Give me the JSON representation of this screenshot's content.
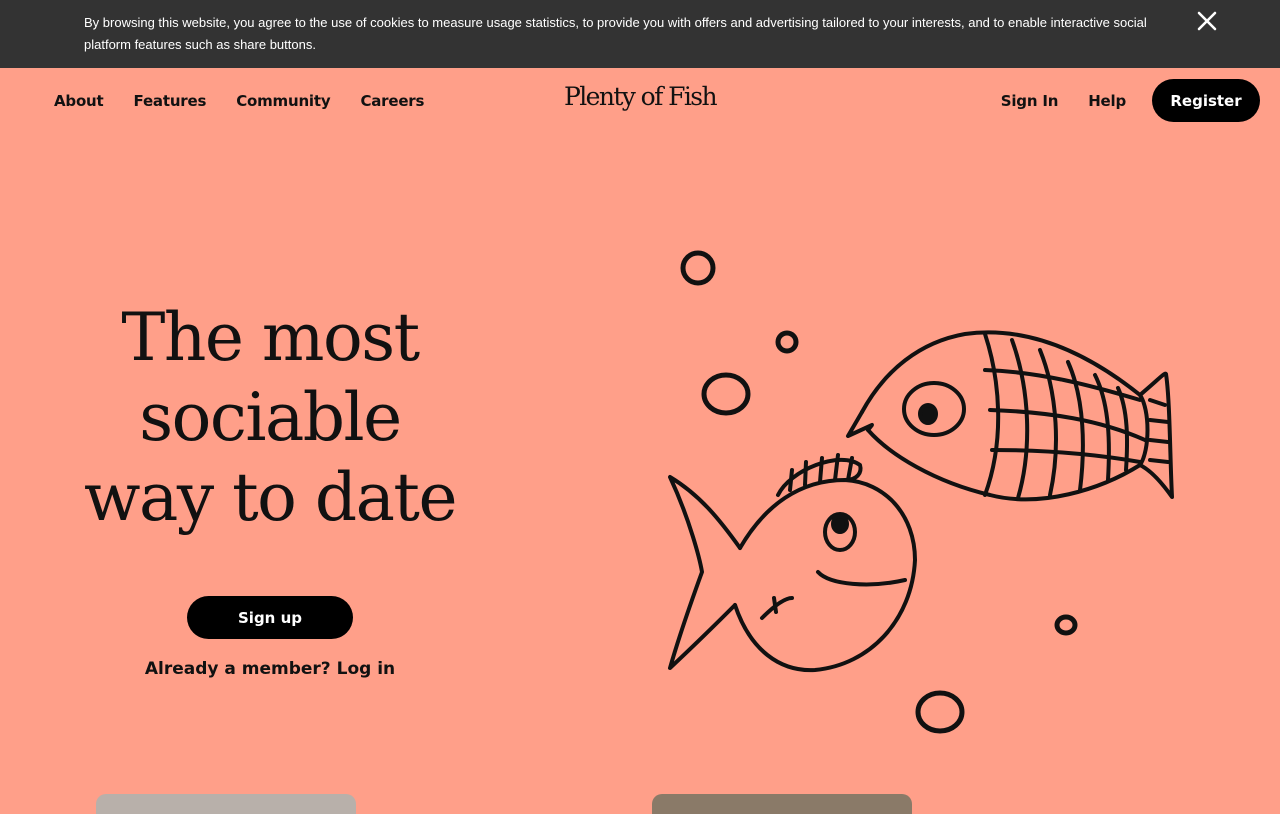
{
  "cookie_banner": {
    "text": "By browsing this website, you agree to the use of cookies to measure usage statistics, to provide you with offers and advertising tailored to your interests, and to enable interactive social platform features such as share buttons.",
    "close_icon": "close-icon"
  },
  "nav": {
    "left_links": [
      "About",
      "Features",
      "Community",
      "Careers"
    ],
    "logo": "Plenty of Fish",
    "sign_in": "Sign In",
    "help": "Help",
    "register": "Register"
  },
  "hero": {
    "title_lines": [
      "The most",
      "sociable",
      "way to date"
    ],
    "signup_label": "Sign up",
    "member_prompt": "Already a member?",
    "login_label": "Log in",
    "illustration_icon": "two-fish-illustration"
  },
  "colors": {
    "background": "#ff9f89",
    "banner": "#333333",
    "button": "#000000",
    "button_text": "#ffffff"
  }
}
